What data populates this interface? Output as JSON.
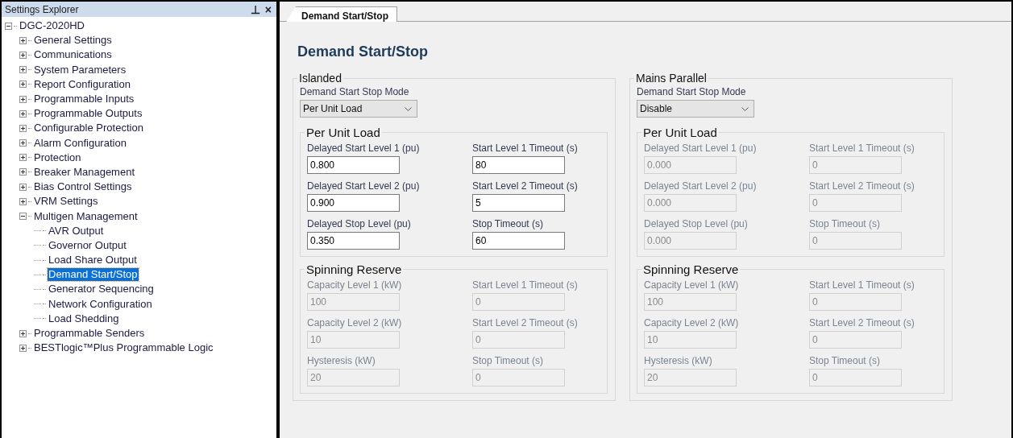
{
  "explorer": {
    "title": "Settings Explorer",
    "pin": "⊥",
    "close": "×",
    "tree": [
      {
        "label": "DGC-2020HD",
        "expanded": true,
        "selected": false,
        "children": [
          {
            "label": "General Settings",
            "expanded": false,
            "selected": false
          },
          {
            "label": "Communications",
            "expanded": false,
            "selected": false
          },
          {
            "label": "System Parameters",
            "expanded": false,
            "selected": false
          },
          {
            "label": "Report Configuration",
            "expanded": false,
            "selected": false
          },
          {
            "label": "Programmable Inputs",
            "expanded": false,
            "selected": false
          },
          {
            "label": "Programmable Outputs",
            "expanded": false,
            "selected": false
          },
          {
            "label": "Configurable Protection",
            "expanded": false,
            "selected": false
          },
          {
            "label": "Alarm Configuration",
            "expanded": false,
            "selected": false
          },
          {
            "label": "Protection",
            "expanded": false,
            "selected": false
          },
          {
            "label": "Breaker Management",
            "expanded": false,
            "selected": false
          },
          {
            "label": "Bias Control Settings",
            "expanded": false,
            "selected": false
          },
          {
            "label": "VRM Settings",
            "expanded": false,
            "selected": false
          },
          {
            "label": "Multigen Management",
            "expanded": true,
            "selected": false,
            "children": [
              {
                "label": "AVR Output",
                "selected": false
              },
              {
                "label": "Governor Output",
                "selected": false
              },
              {
                "label": "Load Share Output",
                "selected": false
              },
              {
                "label": "Demand Start/Stop",
                "selected": true
              },
              {
                "label": "Generator Sequencing",
                "selected": false
              },
              {
                "label": "Network Configuration",
                "selected": false
              },
              {
                "label": "Load Shedding",
                "selected": false
              }
            ]
          },
          {
            "label": "Programmable Senders",
            "expanded": false,
            "selected": false
          },
          {
            "label": "BESTlogic™Plus Programmable Logic",
            "expanded": false,
            "selected": false
          }
        ]
      }
    ]
  },
  "tabs": [
    {
      "label": "Demand Start/Stop",
      "selected": true
    }
  ],
  "heading": "Demand Start/Stop",
  "sections": [
    {
      "title": "Islanded",
      "mode_label": "Demand Start Stop Mode",
      "mode_value": "Per Unit Load",
      "groups": [
        {
          "title": "Per Unit Load",
          "fields": [
            {
              "label": "Delayed Start Level 1 (pu)",
              "value": "0.800",
              "disabled": false
            },
            {
              "label": "Start Level 1 Timeout (s)",
              "value": "80",
              "disabled": false
            },
            {
              "label": "Delayed Start Level 2 (pu)",
              "value": "0.900",
              "disabled": false
            },
            {
              "label": "Start Level 2 Timeout (s)",
              "value": "5",
              "disabled": false
            },
            {
              "label": "Delayed Stop Level (pu)",
              "value": "0.350",
              "disabled": false
            },
            {
              "label": "Stop Timeout (s)",
              "value": "60",
              "disabled": false
            }
          ]
        },
        {
          "title": "Spinning Reserve",
          "fields": [
            {
              "label": "Capacity Level 1 (kW)",
              "value": "100",
              "disabled": true
            },
            {
              "label": "Start Level 1 Timeout (s)",
              "value": "0",
              "disabled": true
            },
            {
              "label": "Capacity Level 2 (kW)",
              "value": "10",
              "disabled": true
            },
            {
              "label": "Start Level 2 Timeout (s)",
              "value": "0",
              "disabled": true
            },
            {
              "label": "Hysteresis (kW)",
              "value": "20",
              "disabled": true
            },
            {
              "label": "Stop Timeout (s)",
              "value": "0",
              "disabled": true
            }
          ]
        }
      ]
    },
    {
      "title": "Mains Parallel",
      "mode_label": "Demand Start Stop Mode",
      "mode_value": "Disable",
      "groups": [
        {
          "title": "Per Unit Load",
          "fields": [
            {
              "label": "Delayed Start Level 1 (pu)",
              "value": "0.000",
              "disabled": true
            },
            {
              "label": "Start Level 1 Timeout (s)",
              "value": "0",
              "disabled": true
            },
            {
              "label": "Delayed Start Level 2 (pu)",
              "value": "0.000",
              "disabled": true
            },
            {
              "label": "Start Level 2 Timeout (s)",
              "value": "0",
              "disabled": true
            },
            {
              "label": "Delayed Stop Level (pu)",
              "value": "0.000",
              "disabled": true
            },
            {
              "label": "Stop Timeout (s)",
              "value": "0",
              "disabled": true
            }
          ]
        },
        {
          "title": "Spinning Reserve",
          "fields": [
            {
              "label": "Capacity Level 1 (kW)",
              "value": "100",
              "disabled": true
            },
            {
              "label": "Start Level 1 Timeout (s)",
              "value": "0",
              "disabled": true
            },
            {
              "label": "Capacity Level 2 (kW)",
              "value": "10",
              "disabled": true
            },
            {
              "label": "Start Level 2 Timeout (s)",
              "value": "0",
              "disabled": true
            },
            {
              "label": "Hysteresis (kW)",
              "value": "20",
              "disabled": true
            },
            {
              "label": "Stop Timeout (s)",
              "value": "0",
              "disabled": true
            }
          ]
        }
      ]
    }
  ]
}
